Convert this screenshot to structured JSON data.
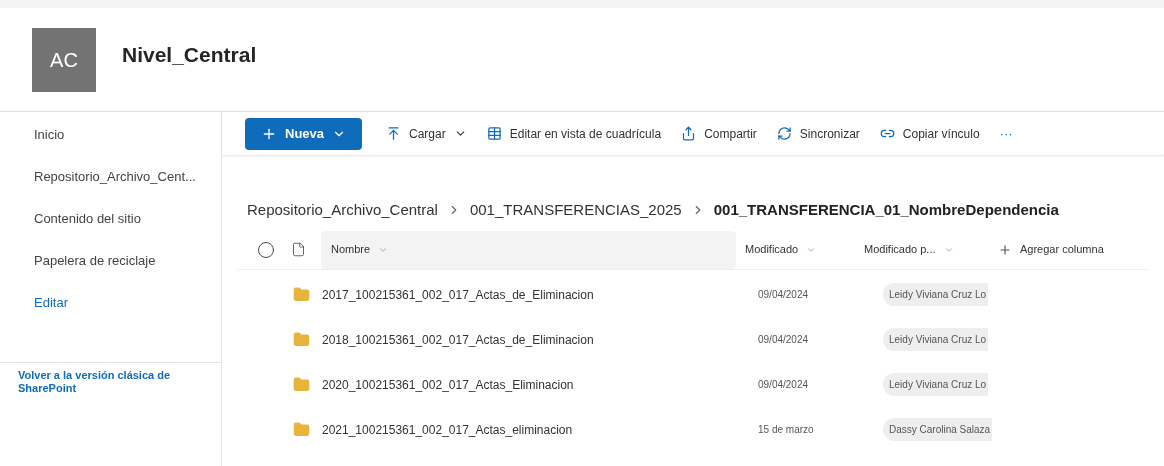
{
  "site": {
    "avatar": "AC",
    "title": "Nivel_Central"
  },
  "sidebar": {
    "items": [
      {
        "label": "Inicio",
        "kind": "nav"
      },
      {
        "label": "Repositorio_Archivo_Cent...",
        "kind": "nav"
      },
      {
        "label": "Contenido del sitio",
        "kind": "nav"
      },
      {
        "label": "Papelera de reciclaje",
        "kind": "nav"
      },
      {
        "label": "Editar",
        "kind": "link"
      }
    ],
    "footer_link": "Volver a la versión clásica de SharePoint"
  },
  "toolbar": [
    {
      "label": "Nueva",
      "kind": "primary",
      "dropdown": true
    },
    {
      "label": "Cargar",
      "kind": "upload",
      "dropdown": true
    },
    {
      "label": "Editar en vista de cuadrícula",
      "kind": "grid",
      "dropdown": false
    },
    {
      "label": "Compartir",
      "kind": "share",
      "dropdown": false
    },
    {
      "label": "Sincronizar",
      "kind": "sync",
      "dropdown": false
    },
    {
      "label": "Copiar vínculo",
      "kind": "link",
      "dropdown": false
    },
    {
      "label": "···",
      "kind": "more",
      "dropdown": false
    }
  ],
  "breadcrumb": [
    {
      "label": "Repositorio_Archivo_Central",
      "current": false
    },
    {
      "label": "001_TRANSFERENCIAS_2025",
      "current": false
    },
    {
      "label": "001_TRANSFERENCIA_01_NombreDependencia",
      "current": true
    }
  ],
  "table": {
    "columns": [
      {
        "label": "Nombre",
        "sort": true
      },
      {
        "label": "Modificado",
        "sort": true
      },
      {
        "label": "Modificado p...",
        "sort": true
      }
    ],
    "add_column": "Agregar columna",
    "rows": [
      {
        "name": "2017_100215361_002_017_Actas_de_Eliminacion",
        "modified": "09/04/2024",
        "modified_by": "Leidy Viviana Cruz Lo"
      },
      {
        "name": "2018_100215361_002_017_Actas_de_Eliminacion",
        "modified": "09/04/2024",
        "modified_by": "Leidy Viviana Cruz Lo"
      },
      {
        "name": "2020_100215361_002_017_Actas_Eliminacion",
        "modified": "09/04/2024",
        "modified_by": "Leidy Viviana Cruz Lo"
      },
      {
        "name": "2021_100215361_002_017_Actas_eliminacion",
        "modified": "15 de marzo",
        "modified_by": "Dassy Carolina Salaza"
      }
    ]
  }
}
